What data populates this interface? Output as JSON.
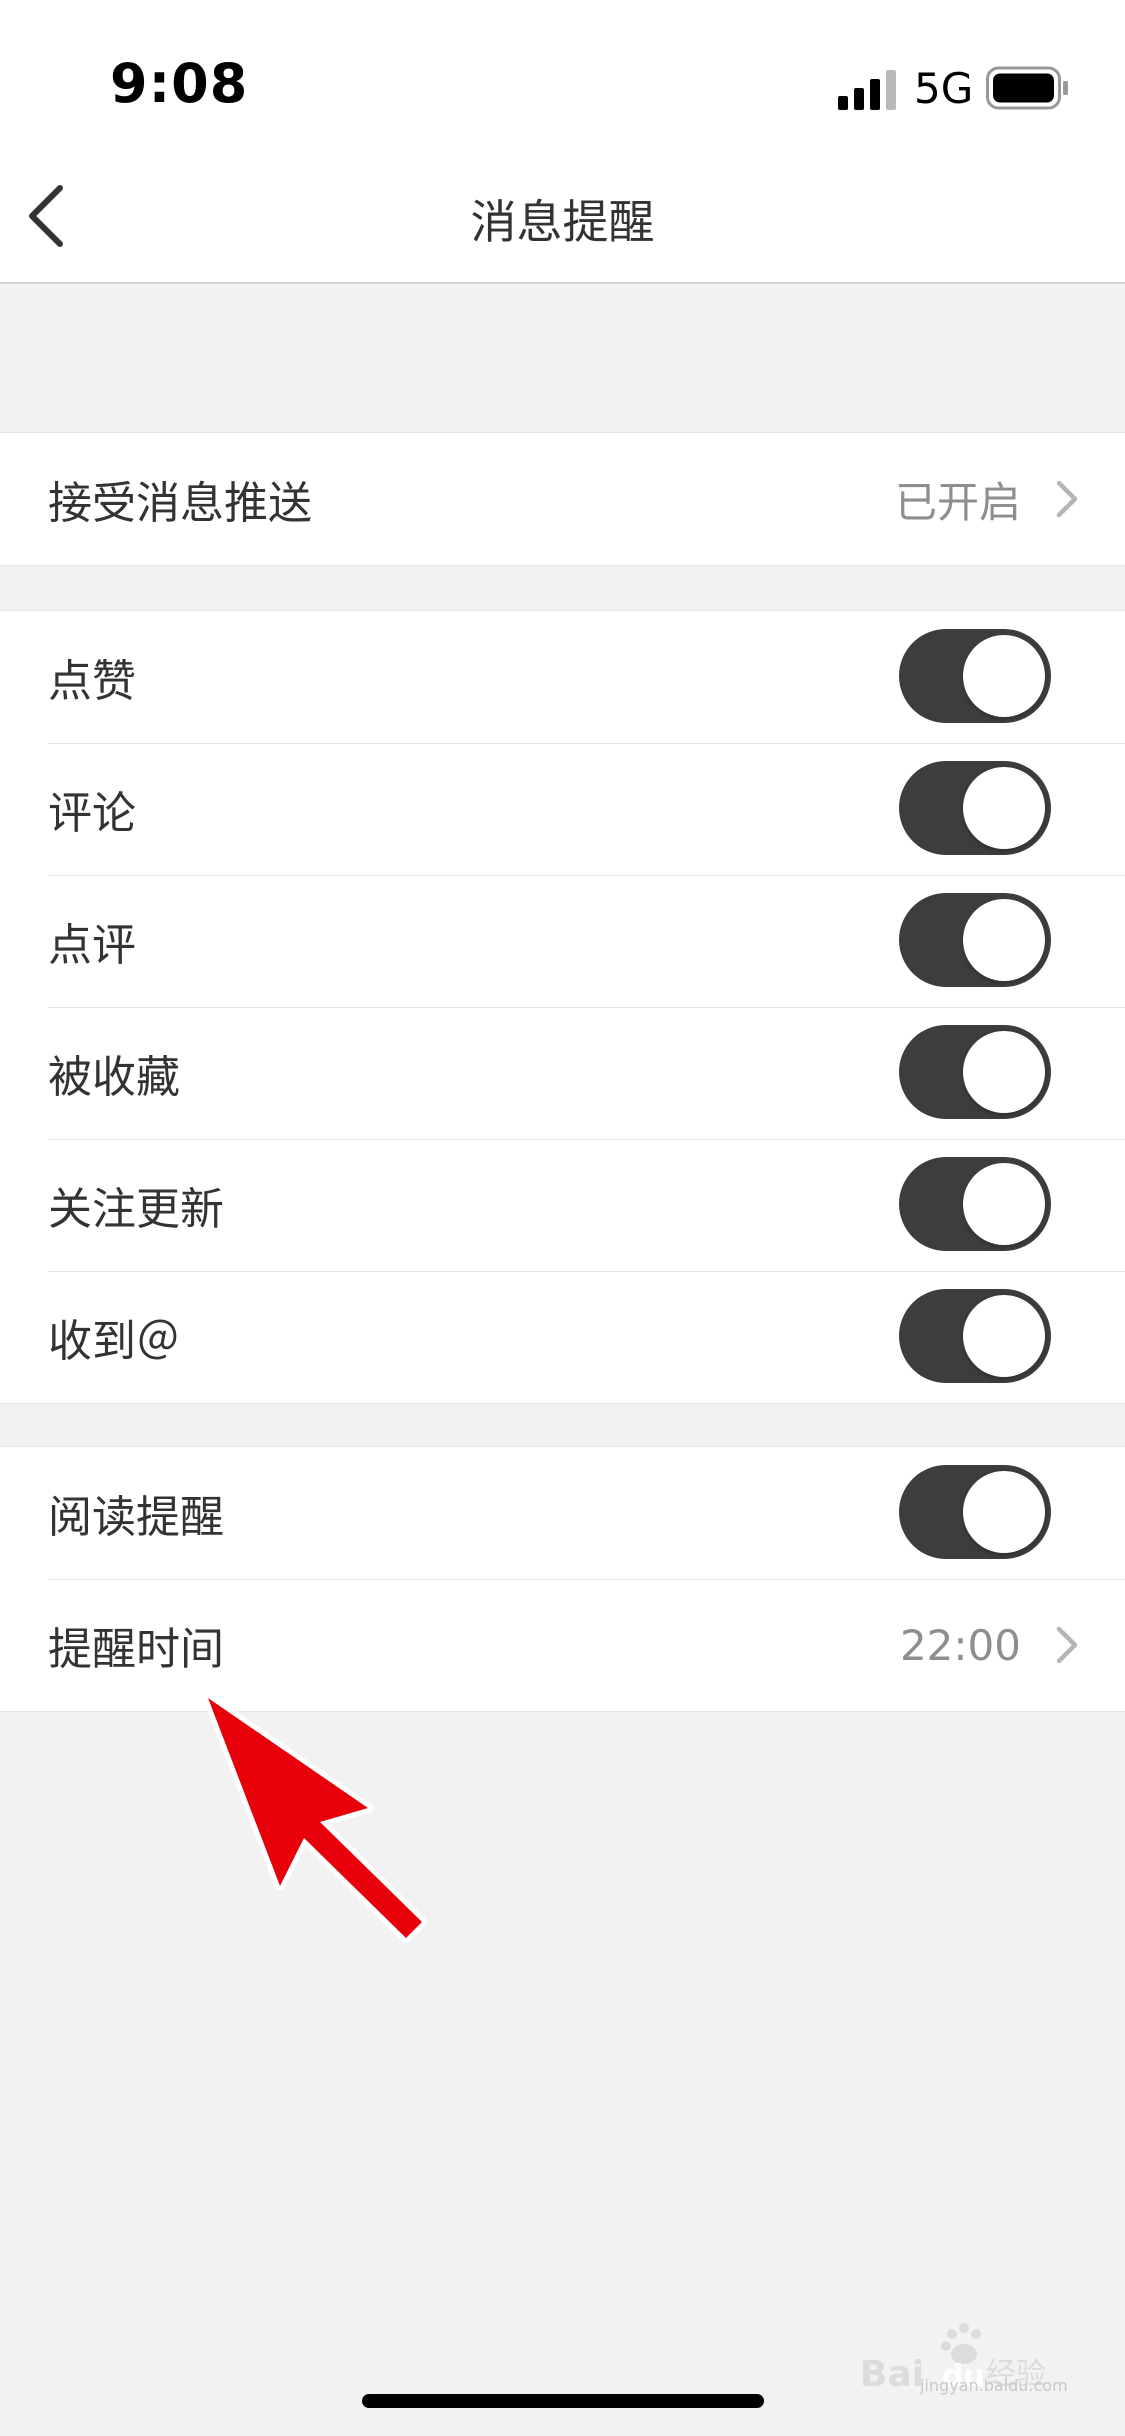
{
  "status_bar": {
    "time": "9:08",
    "network": "5G",
    "icons": [
      "signal-icon",
      "battery-icon"
    ]
  },
  "nav": {
    "title": "消息提醒",
    "back_icon": "chevron-left-icon"
  },
  "push_section": {
    "label": "接受消息推送",
    "value": "已开启"
  },
  "notification_section": {
    "items": [
      {
        "label": "点赞",
        "enabled": true
      },
      {
        "label": "评论",
        "enabled": true
      },
      {
        "label": "点评",
        "enabled": true
      },
      {
        "label": "被收藏",
        "enabled": true
      },
      {
        "label": "关注更新",
        "enabled": true
      },
      {
        "label": "收到＠",
        "enabled": true
      }
    ]
  },
  "reading_section": {
    "reminder_label": "阅读提醒",
    "reminder_enabled": true,
    "time_label": "提醒时间",
    "time_value": "22:00"
  },
  "watermark": {
    "text": "Bai du 经验",
    "url_text": "jingyan.baidu.com"
  },
  "colors": {
    "toggle_on": "#3d3d3d",
    "background": "#f2f2f2",
    "annotation_arrow": "#e8000b"
  }
}
